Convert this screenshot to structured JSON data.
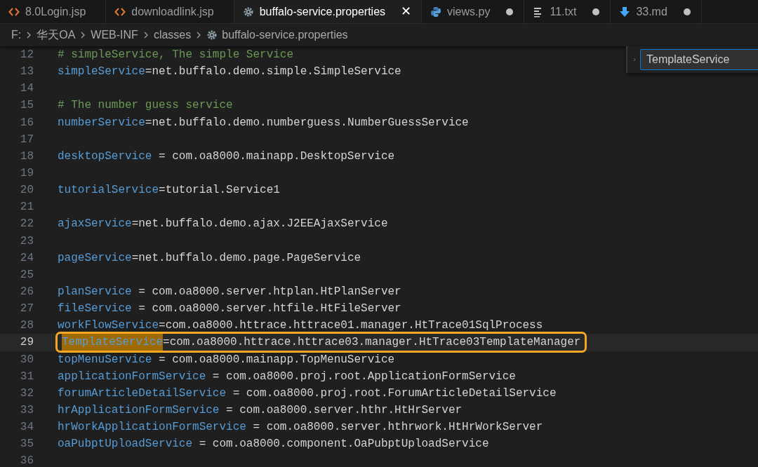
{
  "tabs": [
    {
      "label": "8.0Login.jsp",
      "kind": "code",
      "selected": false,
      "modified": false
    },
    {
      "label": "downloadlink.jsp",
      "kind": "code",
      "selected": false,
      "modified": false
    },
    {
      "label": "buffalo-service.properties",
      "kind": "settings",
      "selected": true,
      "modified": false,
      "close": "✕"
    },
    {
      "label": "views.py",
      "kind": "python",
      "selected": false,
      "modified": true
    },
    {
      "label": "11.txt",
      "kind": "text",
      "selected": false,
      "modified": true
    },
    {
      "label": "33.md",
      "kind": "markdown",
      "selected": false,
      "modified": true
    }
  ],
  "breadcrumb": [
    {
      "label": "F:",
      "kind": "folder"
    },
    {
      "label": "华天OA",
      "kind": "folder"
    },
    {
      "label": "WEB-INF",
      "kind": "folder"
    },
    {
      "label": "classes",
      "kind": "folder"
    },
    {
      "label": "buffalo-service.properties",
      "kind": "settings"
    }
  ],
  "find_widget": {
    "value": "TemplateService"
  },
  "lines": [
    {
      "number": "12",
      "kind": "comment",
      "text": "# simpleService, The simple Service",
      "current": false
    },
    {
      "number": "13",
      "kind": "entry",
      "key": "simpleService",
      "value": "=net.buffalo.demo.simple.SimpleService",
      "current": false
    },
    {
      "number": "14",
      "kind": "blank",
      "current": false
    },
    {
      "number": "15",
      "kind": "comment",
      "text": "# The number guess service",
      "current": false
    },
    {
      "number": "16",
      "kind": "entry",
      "key": "numberService",
      "value": "=net.buffalo.demo.numberguess.NumberGuessService",
      "current": false
    },
    {
      "number": "17",
      "kind": "blank",
      "current": false
    },
    {
      "number": "18",
      "kind": "entry",
      "key": "desktopService",
      "value": " = com.oa8000.mainapp.DesktopService",
      "current": false
    },
    {
      "number": "19",
      "kind": "blank",
      "current": false
    },
    {
      "number": "20",
      "kind": "entry",
      "key": "tutorialService",
      "value": "=tutorial.Service1",
      "current": false
    },
    {
      "number": "21",
      "kind": "blank",
      "current": false
    },
    {
      "number": "22",
      "kind": "entry",
      "key": "ajaxService",
      "value": "=net.buffalo.demo.ajax.J2EEAjaxService",
      "current": false
    },
    {
      "number": "23",
      "kind": "blank",
      "current": false
    },
    {
      "number": "24",
      "kind": "entry",
      "key": "pageService",
      "value": "=net.buffalo.demo.page.PageService",
      "current": false
    },
    {
      "number": "25",
      "kind": "blank",
      "current": false
    },
    {
      "number": "26",
      "kind": "entry",
      "key": "planService",
      "value": " = com.oa8000.server.htplan.HtPlanServer",
      "current": false
    },
    {
      "number": "27",
      "kind": "entry",
      "key": "fileService",
      "value": " = com.oa8000.server.htfile.HtFileServer",
      "current": false
    },
    {
      "number": "28",
      "kind": "entry",
      "key": "workFlowService",
      "value": "=com.oa8000.httrace.httrace01.manager.HtTrace01SqlProcess",
      "current": false
    },
    {
      "number": "29",
      "kind": "entry",
      "key": "TemplateService",
      "value": "=com.oa8000.httrace.httrace03.manager.HtTrace03TemplateManager",
      "current": true,
      "match": true,
      "outlined": true
    },
    {
      "number": "30",
      "kind": "entry",
      "key": "topMenuService",
      "value": " = com.oa8000.mainapp.TopMenuService",
      "current": false
    },
    {
      "number": "31",
      "kind": "entry",
      "key": "applicationFormService",
      "value": " = com.oa8000.proj.root.ApplicationFormService",
      "current": false
    },
    {
      "number": "32",
      "kind": "entry",
      "key": "forumArticleDetailService",
      "value": " = com.oa8000.proj.root.ForumArticleDetailService",
      "current": false
    },
    {
      "number": "33",
      "kind": "entry",
      "key": "hrApplicationFormService",
      "value": " = com.oa8000.server.hthr.HtHrServer",
      "current": false
    },
    {
      "number": "34",
      "kind": "entry",
      "key": "hrWorkApplicationFormService",
      "value": " = com.oa8000.server.hthrwork.HtHrWorkServer",
      "current": false
    },
    {
      "number": "35",
      "kind": "entry",
      "key": "oaPubptUploadService",
      "value": " = com.oa8000.component.OaPubptUploadService",
      "current": false
    },
    {
      "number": "36",
      "kind": "blank",
      "current": false
    }
  ]
}
